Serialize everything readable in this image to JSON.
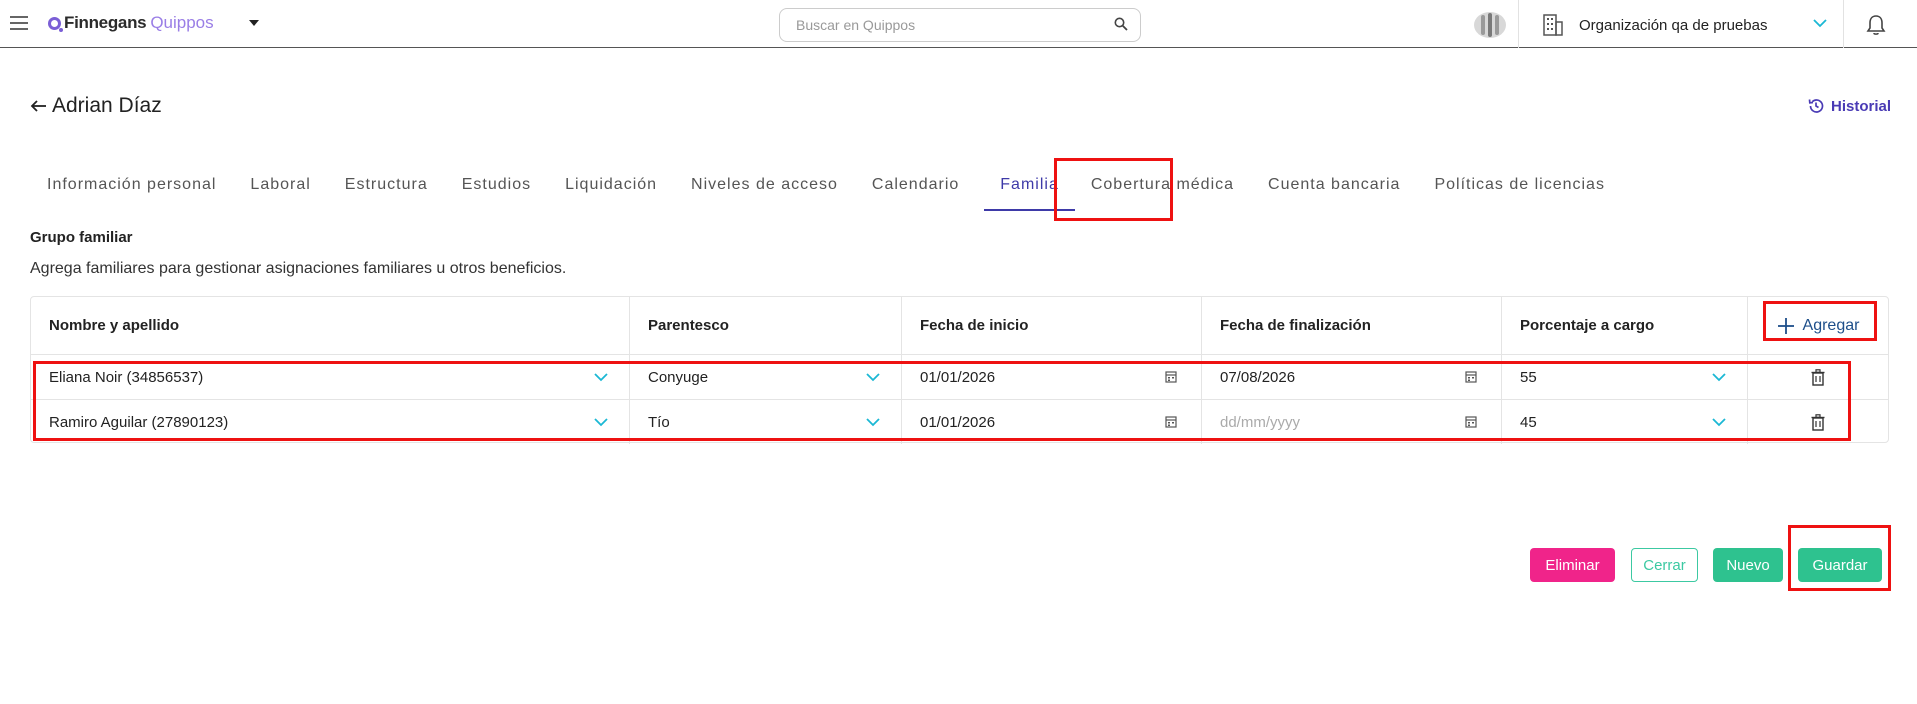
{
  "app": {
    "logo_primary": "Finnegans",
    "logo_secondary": "Quippos"
  },
  "search": {
    "placeholder": "Buscar en Quippos",
    "value": ""
  },
  "organization": {
    "name": "Organización qa de pruebas"
  },
  "header": {
    "title": "Adrian Díaz",
    "historial_label": "Historial"
  },
  "tabs": [
    {
      "label": "Información personal"
    },
    {
      "label": "Laboral"
    },
    {
      "label": "Estructura"
    },
    {
      "label": "Estudios"
    },
    {
      "label": "Liquidación"
    },
    {
      "label": "Niveles de acceso"
    },
    {
      "label": "Calendario"
    },
    {
      "label": "Familia",
      "active": true
    },
    {
      "label": "Cobertura médica"
    },
    {
      "label": "Cuenta bancaria"
    },
    {
      "label": "Políticas de licencias"
    }
  ],
  "section": {
    "title": "Grupo familiar",
    "description": "Agrega familiares para gestionar asignaciones familiares u otros beneficios."
  },
  "table": {
    "columns": [
      "Nombre y apellido",
      "Parentesco",
      "Fecha de inicio",
      "Fecha de finalización",
      "Porcentaje a cargo"
    ],
    "add_label": "Agregar",
    "date_placeholder": "dd/mm/yyyy",
    "rows": [
      {
        "name": "Eliana Noir (34856537)",
        "relation": "Conyuge",
        "start": "01/01/2026",
        "end": "07/08/2026",
        "percent": "55"
      },
      {
        "name": "Ramiro Aguilar (27890123)",
        "relation": "Tío",
        "start": "01/01/2026",
        "end": "",
        "percent": "45"
      }
    ]
  },
  "actions": {
    "delete_label": "Eliminar",
    "close_label": "Cerrar",
    "new_label": "Nuevo",
    "save_label": "Guardar"
  },
  "colors": {
    "accent": "#3e3aa8",
    "delete": "#f0248a",
    "success": "#2ec28f",
    "highlight": "#ee1111"
  }
}
